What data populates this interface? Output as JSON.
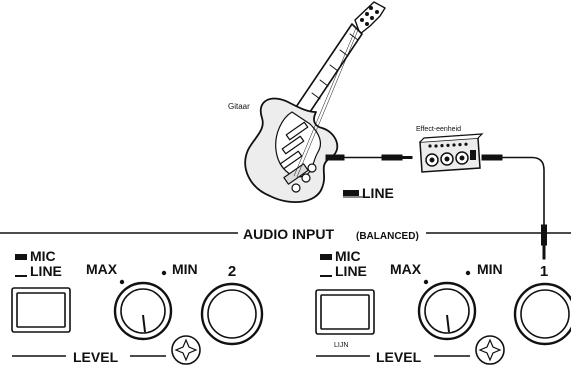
{
  "labels": {
    "guitar": "Gitaar",
    "effect_unit": "Effect-eenheid",
    "line_switch": "LINE",
    "audio_input": "AUDIO INPUT",
    "balanced": "(BALANCED)",
    "mic": "MIC",
    "line": "LINE",
    "max": "MAX",
    "min": "MIN",
    "level": "LEVEL",
    "lijn": "LIJN"
  },
  "channels": [
    {
      "number": "2"
    },
    {
      "number": "1"
    }
  ]
}
